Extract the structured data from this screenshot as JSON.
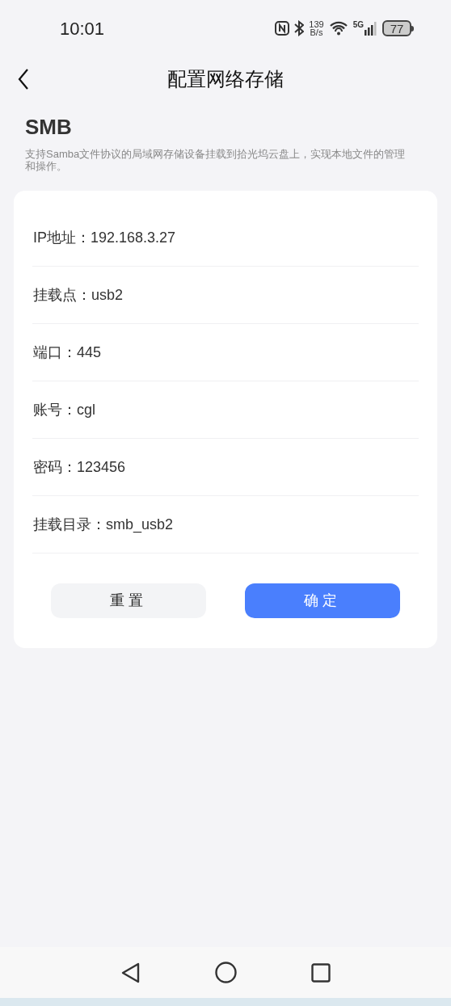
{
  "status_bar": {
    "time": "10:01",
    "speed_value": "139",
    "speed_unit": "B/s",
    "network": "5G",
    "battery": "77"
  },
  "header": {
    "title": "配置网络存储"
  },
  "section": {
    "title": "SMB",
    "description": "支持Samba文件协议的局域网存储设备挂载到拾光坞云盘上，实现本地文件的管理和操作。"
  },
  "fields": [
    {
      "label": "IP地址：",
      "value": "192.168.3.27"
    },
    {
      "label": "挂载点：",
      "value": "usb2"
    },
    {
      "label": "端口：",
      "value": "445"
    },
    {
      "label": "账号：",
      "value": "cgl"
    },
    {
      "label": "密码：",
      "value": "123456"
    },
    {
      "label": "挂载目录：",
      "value": "smb_usb2"
    }
  ],
  "buttons": [
    {
      "label": "重置",
      "kind": "secondary"
    },
    {
      "label": "确定",
      "kind": "primary"
    }
  ]
}
